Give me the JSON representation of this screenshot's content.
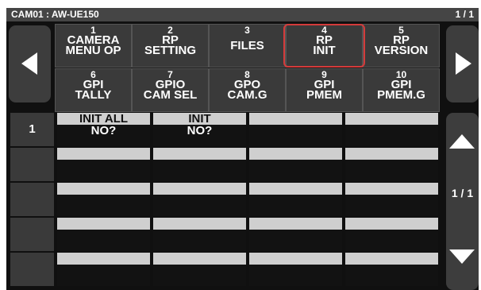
{
  "window": {
    "title": "CAM01 : AW-UE150",
    "page": "1 / 1"
  },
  "menu_tiles": [
    {
      "num": "1",
      "label1": "CAMERA",
      "label2": "MENU OP"
    },
    {
      "num": "2",
      "label1": "RP",
      "label2": "SETTING"
    },
    {
      "num": "3",
      "label1": "FILES",
      "label2": ""
    },
    {
      "num": "4",
      "label1": "RP",
      "label2": "INIT"
    },
    {
      "num": "5",
      "label1": "RP",
      "label2": "VERSION"
    },
    {
      "num": "6",
      "label1": "GPI",
      "label2": "TALLY"
    },
    {
      "num": "7",
      "label1": "GPIO",
      "label2": "CAM SEL"
    },
    {
      "num": "8",
      "label1": "GPO",
      "label2": "CAM.G"
    },
    {
      "num": "9",
      "label1": "GPI",
      "label2": "PMEM"
    },
    {
      "num": "10",
      "label1": "GPI",
      "label2": "PMEM.G"
    }
  ],
  "selected_tile": "4",
  "highlight_color": "#d43b3b",
  "grid": {
    "rows": [
      {
        "num": "1",
        "cells": [
          {
            "l1": "INIT ALL",
            "l2": "NO?"
          },
          {
            "l1": "INIT",
            "l2": "NO?"
          },
          {
            "l1": "",
            "l2": ""
          },
          {
            "l1": "",
            "l2": ""
          }
        ]
      },
      {
        "num": "",
        "cells": [
          {
            "l1": "",
            "l2": ""
          },
          {
            "l1": "",
            "l2": ""
          },
          {
            "l1": "",
            "l2": ""
          },
          {
            "l1": "",
            "l2": ""
          }
        ]
      },
      {
        "num": "",
        "cells": [
          {
            "l1": "",
            "l2": ""
          },
          {
            "l1": "",
            "l2": ""
          },
          {
            "l1": "",
            "l2": ""
          },
          {
            "l1": "",
            "l2": ""
          }
        ]
      },
      {
        "num": "",
        "cells": [
          {
            "l1": "",
            "l2": ""
          },
          {
            "l1": "",
            "l2": ""
          },
          {
            "l1": "",
            "l2": ""
          },
          {
            "l1": "",
            "l2": ""
          }
        ]
      },
      {
        "num": "",
        "cells": [
          {
            "l1": "",
            "l2": ""
          },
          {
            "l1": "",
            "l2": ""
          },
          {
            "l1": "",
            "l2": ""
          },
          {
            "l1": "",
            "l2": ""
          }
        ]
      }
    ]
  },
  "pager": {
    "label": "1 / 1"
  },
  "icons": {
    "prev": "triangle-left-icon",
    "next": "triangle-right-icon",
    "up": "triangle-up-icon",
    "down": "triangle-down-icon"
  }
}
